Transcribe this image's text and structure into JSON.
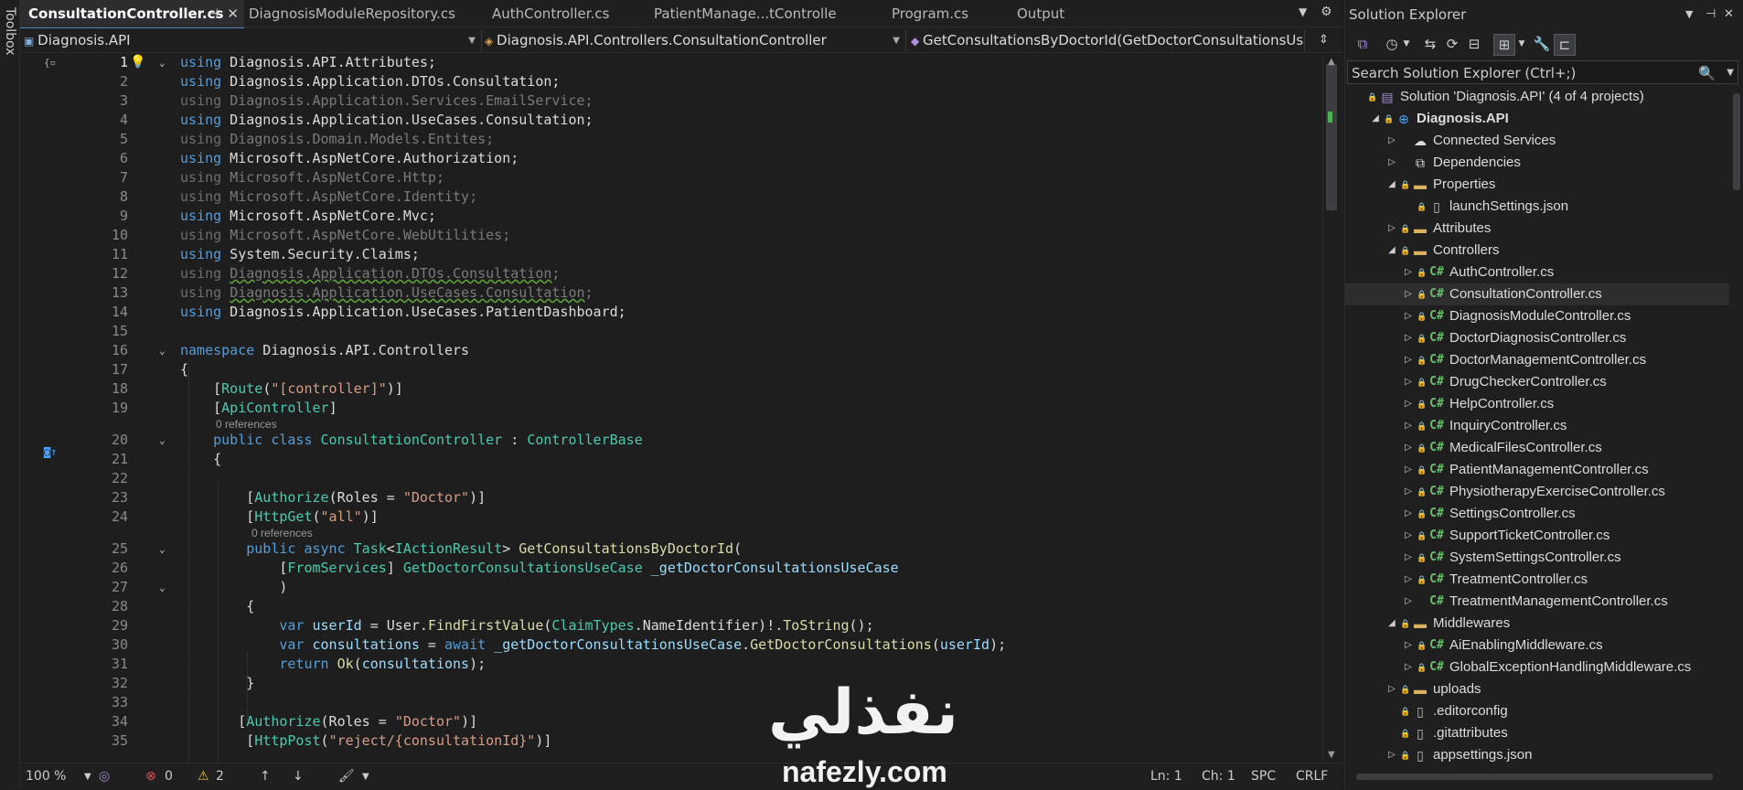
{
  "toolbox": {
    "label": "Toolbox"
  },
  "editor": {
    "tabs": [
      {
        "label": "ConsultationController.cs",
        "pin": "⊣",
        "close": "✕"
      },
      {
        "label": "DiagnosisModuleRepository.cs"
      },
      {
        "label": "AuthController.cs"
      },
      {
        "label": "PatientManage...tController.cs"
      },
      {
        "label": "Program.cs"
      },
      {
        "label": "Output"
      }
    ],
    "nav": {
      "project": "Diagnosis.API",
      "type": "Diagnosis.API.Controllers.ConsultationController",
      "member": "GetConsultationsByDoctorId(GetDoctorConsultationsUseCase _g"
    },
    "lines": [
      {
        "n": "1",
        "html": "<span class=\"kw\">using</span> Diagnosis.API.Attributes;"
      },
      {
        "n": "2",
        "html": "<span class=\"kw\">using</span> Diagnosis.Application.DTOs.Consultation;"
      },
      {
        "n": "3",
        "html": "<span class=\"dim\">using</span> <span class=\"dimty\">Diagnosis.Application.Services.EmailService;</span>"
      },
      {
        "n": "4",
        "html": "<span class=\"kw\">using</span> Diagnosis.Application.UseCases.Consultation;"
      },
      {
        "n": "5",
        "html": "<span class=\"dim\">using</span> <span class=\"dimty\">Diagnosis.Domain.Models.Entites;</span>"
      },
      {
        "n": "6",
        "html": "<span class=\"kw\">using</span> Microsoft.AspNetCore.Authorization;"
      },
      {
        "n": "7",
        "html": "<span class=\"dim\">using</span> <span class=\"dimty\">Microsoft.AspNetCore.Http;</span>"
      },
      {
        "n": "8",
        "html": "<span class=\"dim\">using</span> <span class=\"dimty\">Microsoft.AspNetCore.Identity;</span>"
      },
      {
        "n": "9",
        "html": "<span class=\"kw\">using</span> Microsoft.AspNetCore.Mvc;"
      },
      {
        "n": "10",
        "html": "<span class=\"dim\">using</span> <span class=\"dimty\">Microsoft.AspNetCore.WebUtilities;</span>"
      },
      {
        "n": "11",
        "html": "<span class=\"kw\">using</span> System.Security.Claims;"
      },
      {
        "n": "12",
        "html": "<span class=\"dim\">using</span> <span class=\"dimty squig\">Diagnosis.Application.DTOs.Consultation</span><span class=\"dimty\">;</span>"
      },
      {
        "n": "13",
        "html": "<span class=\"dim\">using</span> <span class=\"dimty squig\">Diagnosis.Application.UseCases.Consultation</span><span class=\"dimty\">;</span>"
      },
      {
        "n": "14",
        "html": "<span class=\"kw\">using</span> Diagnosis.Application.UseCases.PatientDashboard;"
      },
      {
        "n": "15",
        "html": ""
      },
      {
        "n": "16",
        "html": "<span class=\"kw\">namespace</span> Diagnosis.API.Controllers"
      },
      {
        "n": "17",
        "html": "{"
      },
      {
        "n": "18",
        "html": "    [<span class=\"ty\">Route</span>(<span class=\"st\">\"[controller]\"</span>)]"
      },
      {
        "n": "19",
        "html": "    [<span class=\"ty\">ApiController</span>]",
        "lens": "0 references"
      },
      {
        "n": "20",
        "html": "    <span class=\"kw\">public</span> <span class=\"kw\">class</span> <span class=\"ty\">ConsultationController</span> : <span class=\"ty\">ControllerBase</span>"
      },
      {
        "n": "21",
        "html": "    {"
      },
      {
        "n": "22",
        "html": ""
      },
      {
        "n": "23",
        "html": "        [<span class=\"ty\">Authorize</span>(Roles = <span class=\"st\">\"Doctor\"</span>)]"
      },
      {
        "n": "24",
        "html": "        [<span class=\"ty\">HttpGet</span>(<span class=\"st\">\"all\"</span>)]",
        "lens": "0 references"
      },
      {
        "n": "25",
        "html": "        <span class=\"kw\">public</span> <span class=\"kw\">async</span> <span class=\"ty\">Task</span>&lt;<span class=\"ty\">IActionResult</span>&gt; <span class=\"fn\">GetConsultationsByDoctorId</span>("
      },
      {
        "n": "26",
        "html": "            [<span class=\"ty\">FromServices</span>] <span class=\"ty\">GetDoctorConsultationsUseCase</span> <span class=\"pr\">_getDoctorConsultationsUseCase</span>"
      },
      {
        "n": "27",
        "html": "            )"
      },
      {
        "n": "28",
        "html": "        {"
      },
      {
        "n": "29",
        "html": "            <span class=\"kw\">var</span> <span class=\"pr\">userId</span> = User.<span class=\"fn\">FindFirstValue</span>(<span class=\"ty\">ClaimTypes</span>.NameIdentifier)!.<span class=\"fn\">ToString</span>();"
      },
      {
        "n": "30",
        "html": "            <span class=\"kw\">var</span> <span class=\"pr\">consultations</span> = <span class=\"kw\">await</span> <span class=\"pr\">_getDoctorConsultationsUseCase</span>.<span class=\"fn\">GetDoctorConsultations</span>(<span class=\"pr\">userId</span>);"
      },
      {
        "n": "31",
        "html": "            <span class=\"kw\">return</span> <span class=\"fn\">Ok</span>(<span class=\"pr\">consultations</span>);"
      },
      {
        "n": "32",
        "html": "        }"
      },
      {
        "n": "33",
        "html": ""
      },
      {
        "n": "34",
        "html": "       [<span class=\"ty\">Authorize</span>(Roles = <span class=\"st\">\"Doctor\"</span>)]"
      },
      {
        "n": "35",
        "html": "        [<span class=\"ty\">HttpPost</span>(<span class=\"st\">\"reject/{consultationId}\"</span>)]"
      }
    ],
    "status": {
      "zoom": "100 %",
      "errors": "0",
      "warnings": "2",
      "ln": "Ln: 1",
      "ch": "Ch: 1",
      "spc": "SPC",
      "crlf": "CRLF"
    }
  },
  "solution_explorer": {
    "title": "Solution Explorer",
    "search_placeholder": "Search Solution Explorer (Ctrl+;)",
    "tree": [
      {
        "label": "Solution 'Diagnosis.API' (4 of 4 projects)",
        "kind": "sln",
        "depth": 0,
        "expander": ""
      },
      {
        "label": "Diagnosis.API",
        "kind": "proj",
        "depth": 1,
        "expander": "◢",
        "bold": true
      },
      {
        "label": "Connected Services",
        "kind": "svc",
        "depth": 2,
        "expander": "▷"
      },
      {
        "label": "Dependencies",
        "kind": "deps",
        "depth": 2,
        "expander": "▷"
      },
      {
        "label": "Properties",
        "kind": "folder",
        "depth": 2,
        "expander": "◢"
      },
      {
        "label": "launchSettings.json",
        "kind": "file",
        "depth": 3,
        "expander": ""
      },
      {
        "label": "Attributes",
        "kind": "folder",
        "depth": 2,
        "expander": "▷"
      },
      {
        "label": "Controllers",
        "kind": "folder",
        "depth": 2,
        "expander": "◢"
      },
      {
        "label": "AuthController.cs",
        "kind": "cs",
        "depth": 3,
        "expander": "▷"
      },
      {
        "label": "ConsultationController.cs",
        "kind": "cs",
        "depth": 3,
        "expander": "▷",
        "selected": true
      },
      {
        "label": "DiagnosisModuleController.cs",
        "kind": "cs",
        "depth": 3,
        "expander": "▷"
      },
      {
        "label": "DoctorDiagnosisController.cs",
        "kind": "cs",
        "depth": 3,
        "expander": "▷"
      },
      {
        "label": "DoctorManagementController.cs",
        "kind": "cs",
        "depth": 3,
        "expander": "▷"
      },
      {
        "label": "DrugCheckerController.cs",
        "kind": "cs",
        "depth": 3,
        "expander": "▷"
      },
      {
        "label": "HelpController.cs",
        "kind": "cs",
        "depth": 3,
        "expander": "▷"
      },
      {
        "label": "InquiryController.cs",
        "kind": "cs",
        "depth": 3,
        "expander": "▷"
      },
      {
        "label": "MedicalFilesController.cs",
        "kind": "cs",
        "depth": 3,
        "expander": "▷"
      },
      {
        "label": "PatientManagementController.cs",
        "kind": "cs",
        "depth": 3,
        "expander": "▷"
      },
      {
        "label": "PhysiotherapyExerciseController.cs",
        "kind": "cs",
        "depth": 3,
        "expander": "▷"
      },
      {
        "label": "SettingsController.cs",
        "kind": "cs",
        "depth": 3,
        "expander": "▷"
      },
      {
        "label": "SupportTicketController.cs",
        "kind": "cs",
        "depth": 3,
        "expander": "▷"
      },
      {
        "label": "SystemSettingsController.cs",
        "kind": "cs",
        "depth": 3,
        "expander": "▷"
      },
      {
        "label": "TreatmentController.cs",
        "kind": "cs",
        "depth": 3,
        "expander": "▷"
      },
      {
        "label": "TreatmentManagementController.cs",
        "kind": "cs",
        "depth": 3,
        "expander": "▷",
        "nolock": true
      },
      {
        "label": "Middlewares",
        "kind": "folder",
        "depth": 2,
        "expander": "◢"
      },
      {
        "label": "AiEnablingMiddleware.cs",
        "kind": "cs",
        "depth": 3,
        "expander": "▷"
      },
      {
        "label": "GlobalExceptionHandlingMiddleware.cs",
        "kind": "cs",
        "depth": 3,
        "expander": "▷"
      },
      {
        "label": "uploads",
        "kind": "folder",
        "depth": 2,
        "expander": "▷"
      },
      {
        "label": ".editorconfig",
        "kind": "file",
        "depth": 2,
        "expander": ""
      },
      {
        "label": ".gitattributes",
        "kind": "file",
        "depth": 2,
        "expander": ""
      },
      {
        "label": "appsettings.json",
        "kind": "file",
        "depth": 2,
        "expander": "▷"
      }
    ]
  },
  "watermark": {
    "arabic": "نفذلي",
    "latin": "nafezly.com"
  },
  "colors": {
    "accent": "#4f86c6",
    "keyword": "#569cd6",
    "type": "#4ec9b0",
    "string": "#d69d85",
    "method": "#dcdcaa",
    "csharp_icon": "#67c06a"
  }
}
